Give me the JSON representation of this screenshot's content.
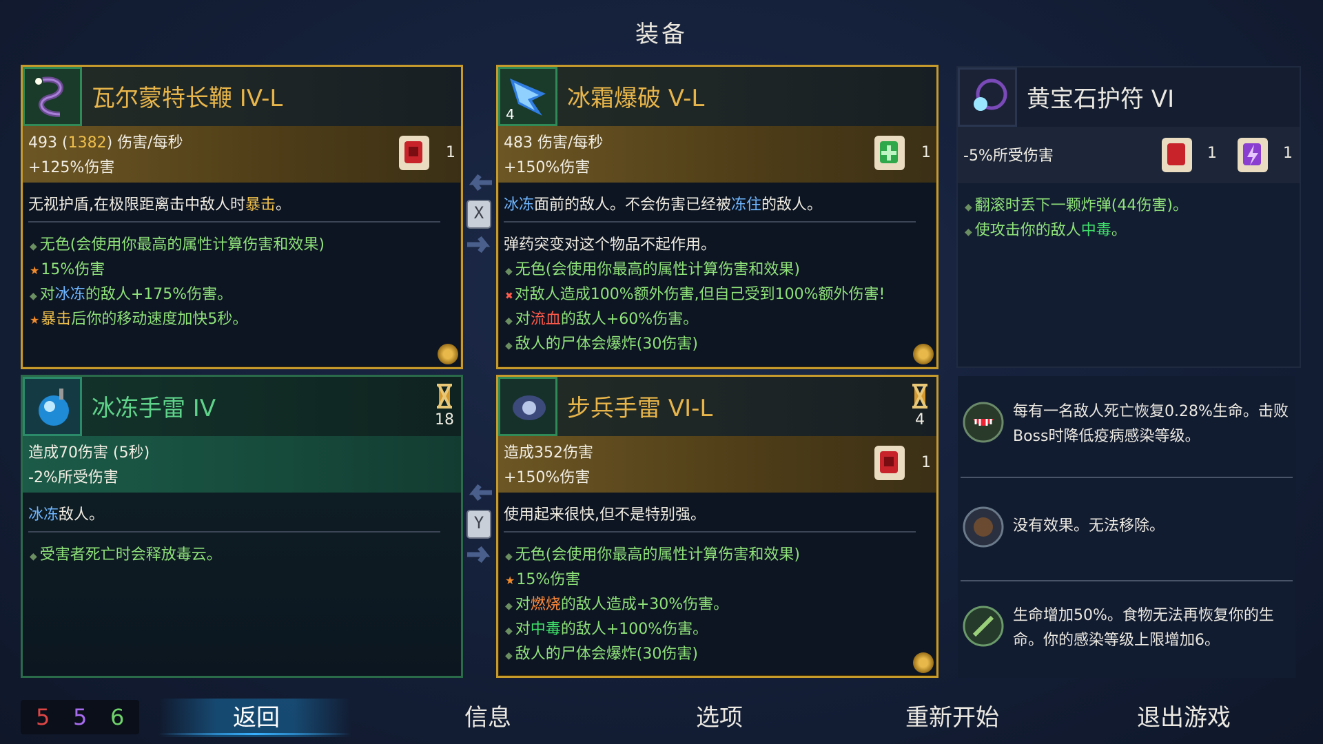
{
  "title": "装备",
  "weapon1": {
    "name": "瓦尔蒙特长鞭 IV-L",
    "dps_base": "493",
    "dps_crit": "1382",
    "dps_unit": "伤害/每秒",
    "damage_bonus": "+125%伤害",
    "scroll_count": "1",
    "desc_pre": "无视护盾,在极限距离击中敌人时",
    "desc_kw": "暴击",
    "desc_post": "。",
    "affixes": [
      {
        "icon": "dot",
        "pre": "无色(会使用你最高的属性计算伤害和效果)",
        "kw": "",
        "post": ""
      },
      {
        "icon": "star",
        "pre": "15%伤害",
        "kw": "",
        "post": ""
      },
      {
        "icon": "dot",
        "pre": "对",
        "kw": "冰冻",
        "post": "的敌人+175%伤害。"
      },
      {
        "icon": "star",
        "pre": "",
        "kw": "暴击",
        "post": "后你的移动速度加快5秒。"
      }
    ]
  },
  "weapon2": {
    "name": "冰霜爆破 V-L",
    "icon_count": "4",
    "dps": "483 伤害/每秒",
    "damage_bonus": "+150%伤害",
    "scroll_count": "1",
    "desc_kw1": "冰冻",
    "desc_mid": "面前的敌人。不会伤害已经被",
    "desc_kw2": "冻住",
    "desc_post": "的敌人。",
    "note": "弹药突变对这个物品不起作用。",
    "affixes": [
      {
        "icon": "dot",
        "pre": "无色(会使用你最高的属性计算伤害和效果)",
        "kw": "",
        "post": ""
      },
      {
        "icon": "curse",
        "pre": "对敌人造成100%额外伤害,但自己受到100%额外伤害!",
        "kw": "",
        "post": ""
      },
      {
        "icon": "dot",
        "pre": "对",
        "kw": "流血",
        "post": "的敌人+60%伤害。"
      },
      {
        "icon": "dot",
        "pre": "敌人的尸体会爆炸(30伤害)",
        "kw": "",
        "post": ""
      }
    ]
  },
  "amulet": {
    "name": "黄宝石护符 VI",
    "stat": "-5%所受伤害",
    "scroll_count_1": "1",
    "scroll_count_2": "1",
    "affix1": "翻滚时丢下一颗炸弹(44伤害)。",
    "affix2_pre": "使攻击你的敌人",
    "affix2_kw": "中毒",
    "affix2_post": "。"
  },
  "skill1": {
    "name": "冰冻手雷 IV",
    "cooldown": "18",
    "stat1": "造成70伤害 (5秒)",
    "stat2": "-2%所受伤害",
    "desc_kw": "冰冻",
    "desc_post": "敌人。",
    "affix1": "受害者死亡时会释放毒云。"
  },
  "skill2": {
    "name": "步兵手雷 VI-L",
    "cooldown": "4",
    "stat1": "造成352伤害",
    "stat2": "+150%伤害",
    "scroll_count": "1",
    "desc": "使用起来很快,但不是特别强。",
    "affixes": [
      {
        "icon": "dot",
        "pre": "无色(会使用你最高的属性计算伤害和效果)",
        "kw": "",
        "post": ""
      },
      {
        "icon": "star",
        "pre": "15%伤害",
        "kw": "",
        "post": ""
      },
      {
        "icon": "dot",
        "pre": "对",
        "kw": "燃烧",
        "post": "的敌人造成+30%伤害。"
      },
      {
        "icon": "dot",
        "pre": "对",
        "kw": "中毒",
        "post": "的敌人+100%伤害。"
      },
      {
        "icon": "dot",
        "pre": "敌人的尸体会爆炸(30伤害)",
        "kw": "",
        "post": ""
      }
    ]
  },
  "swap_keys": {
    "top": "X",
    "bottom": "Y"
  },
  "mutations": [
    {
      "text": "每有一名敌人死亡恢复0.28%生命。击败Boss时降低疫病感染等级。"
    },
    {
      "text": "没有效果。无法移除。"
    },
    {
      "text": "生命增加50%。食物无法再恢复你的生命。你的感染等级上限增加6。"
    }
  ],
  "scrolls": {
    "brutality": "5",
    "tactics": "5",
    "survival": "6"
  },
  "menu": {
    "back": "返回",
    "info": "信息",
    "options": "选项",
    "restart": "重新开始",
    "quit": "退出游戏"
  },
  "colors": {
    "gold": "#e7b54a",
    "green_name": "#5fd38a",
    "brutality": "#e04545",
    "tactics": "#a86cf0",
    "survival": "#6fd36a"
  }
}
